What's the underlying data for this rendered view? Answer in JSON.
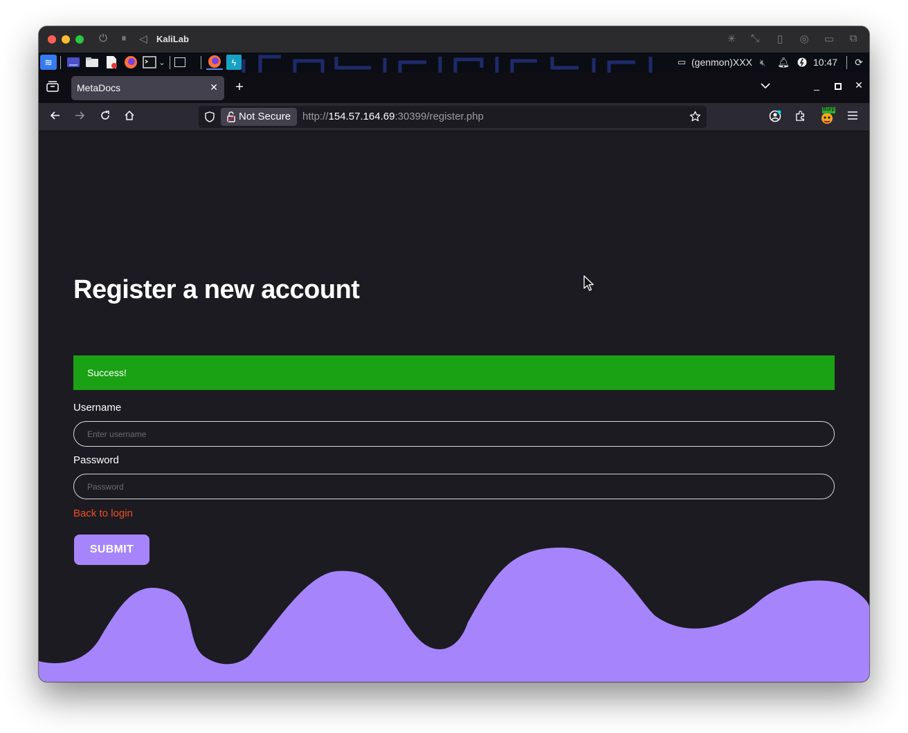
{
  "vm": {
    "title": "KaliLab"
  },
  "panel": {
    "workspace_label": "(genmon)XXX",
    "clock": "10:47"
  },
  "browser": {
    "tab_title": "MetaDocs",
    "security_label": "Not Secure",
    "url_scheme": "http://",
    "url_host": "154.57.164.69",
    "url_rest": ":30399/register.php",
    "burp_badge": "Burp"
  },
  "page": {
    "heading": "Register a new account",
    "alert_text": "Success!",
    "username_label": "Username",
    "username_placeholder": "Enter username",
    "password_label": "Password",
    "password_placeholder": "Password",
    "back_link": "Back to login",
    "submit_label": "SUBMIT"
  },
  "colors": {
    "accent": "#a685fc",
    "success": "#1aa114",
    "link": "#f04e23",
    "page_bg": "#1c1b22"
  }
}
